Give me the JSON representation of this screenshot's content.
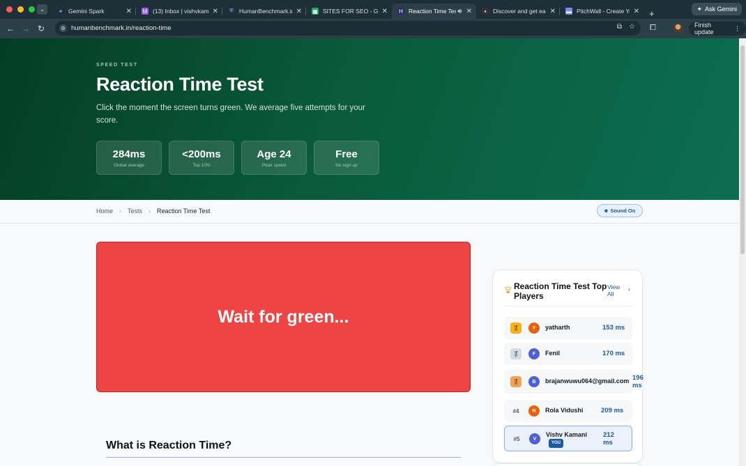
{
  "browser": {
    "tabs": [
      {
        "title": "Gemini Spark",
        "favicon": "gemini-icon",
        "color": "#7aa6ff"
      },
      {
        "title": "(13) Inbox | vishvkam...",
        "favicon": "mail-icon",
        "color": "#8e5cf0"
      },
      {
        "title": "HumanBenchmark.in...",
        "favicon": "shield-icon",
        "color": "#6b7fd6"
      },
      {
        "title": "SITES FOR SEO - Goo...",
        "favicon": "sheets-icon",
        "color": "#1fa463"
      },
      {
        "title": "Reaction Time Tes...",
        "favicon": "hb-icon",
        "color": "#2a2a60"
      },
      {
        "title": "Discover and get earl...",
        "favicon": "page-icon",
        "color": "#333333"
      },
      {
        "title": "PitchWall - Create Yo...",
        "favicon": "pitchwall-icon",
        "color": "#7a8cf0"
      }
    ],
    "ask_gemini": "Ask Gemini",
    "url": "humanbenchmark.in/reaction-time",
    "finish_update": "Finish update"
  },
  "hero": {
    "eyebrow": "SPEED TEST",
    "title": "Reaction Time Test",
    "subtitle": "Click the moment the screen turns green. We average five attempts for your score.",
    "stats": [
      {
        "value": "284ms",
        "caption": "Global average"
      },
      {
        "value": "<200ms",
        "caption": "Top 10%"
      },
      {
        "value": "Age 24",
        "caption": "Peak speed"
      },
      {
        "value": "Free",
        "caption": "No sign-up"
      }
    ]
  },
  "breadcrumb": {
    "home": "Home",
    "tests": "Tests",
    "current": "Reaction Time Test",
    "sound_button": "Sound On"
  },
  "test": {
    "prompt": "Wait for green...",
    "color": "#ef4444"
  },
  "section": {
    "title": "What is Reaction Time?"
  },
  "leaderboard": {
    "title": "Reaction Time Test Top Players",
    "view_all": "View All",
    "players": [
      {
        "rank": "1",
        "medal": "gold",
        "initial": "Y",
        "name": "yatharth",
        "time": "153 ms",
        "avatar_color": "#e8620c"
      },
      {
        "rank": "2",
        "medal": "silver",
        "initial": "F",
        "name": "Fenil",
        "time": "170 ms",
        "avatar_color": "#4f5fd6"
      },
      {
        "rank": "3",
        "medal": "bronze",
        "initial": "B",
        "name": "brajanwuwu064@gmail.com",
        "time": "196 ms",
        "avatar_color": "#4f5fd6"
      },
      {
        "rank": "#4",
        "medal": "none",
        "initial": "R",
        "name": "Rola Vidushi",
        "time": "209 ms",
        "avatar_color": "#e8620c"
      },
      {
        "rank": "#5",
        "medal": "none",
        "initial": "V",
        "name": "Vishv Kamani",
        "time": "212 ms",
        "avatar_color": "#4f5fd6",
        "badge": "YOU"
      }
    ]
  }
}
